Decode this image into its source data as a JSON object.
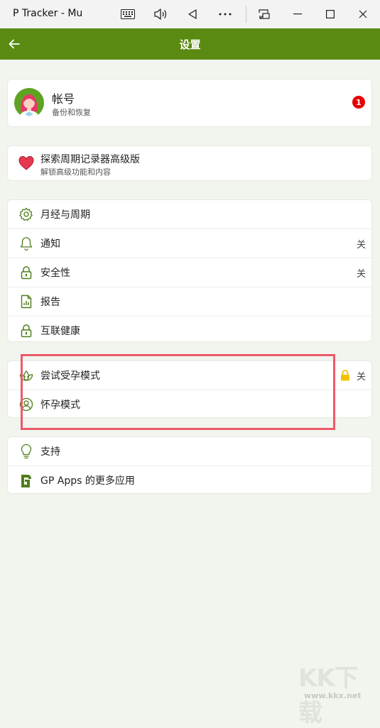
{
  "window": {
    "title": "P Tracker - Mu"
  },
  "appbar": {
    "title": "设置"
  },
  "account": {
    "title": "帐号",
    "subtitle": "备份和恢复",
    "badge": "1"
  },
  "premium": {
    "title": "探索周期记录器高级版",
    "subtitle": "解锁高级功能和内容"
  },
  "group1": [
    {
      "label": "月经与周期",
      "value": ""
    },
    {
      "label": "通知",
      "value": "关"
    },
    {
      "label": "安全性",
      "value": "关"
    },
    {
      "label": "报告",
      "value": ""
    },
    {
      "label": "互联健康",
      "value": ""
    }
  ],
  "group2": [
    {
      "label": "尝试受孕模式",
      "value": "关"
    },
    {
      "label": "怀孕模式",
      "value": ""
    }
  ],
  "group3": [
    {
      "label": "支持"
    },
    {
      "label": "GP Apps 的更多应用"
    }
  ],
  "watermark": {
    "logo": "KK下载",
    "url": "www.kkx.net"
  },
  "colors": {
    "header": "#5a8a12",
    "icon": "#4f7d1b",
    "badge": "#e60000",
    "highlight": "#ec5a6b",
    "lock": "#f2c200"
  }
}
